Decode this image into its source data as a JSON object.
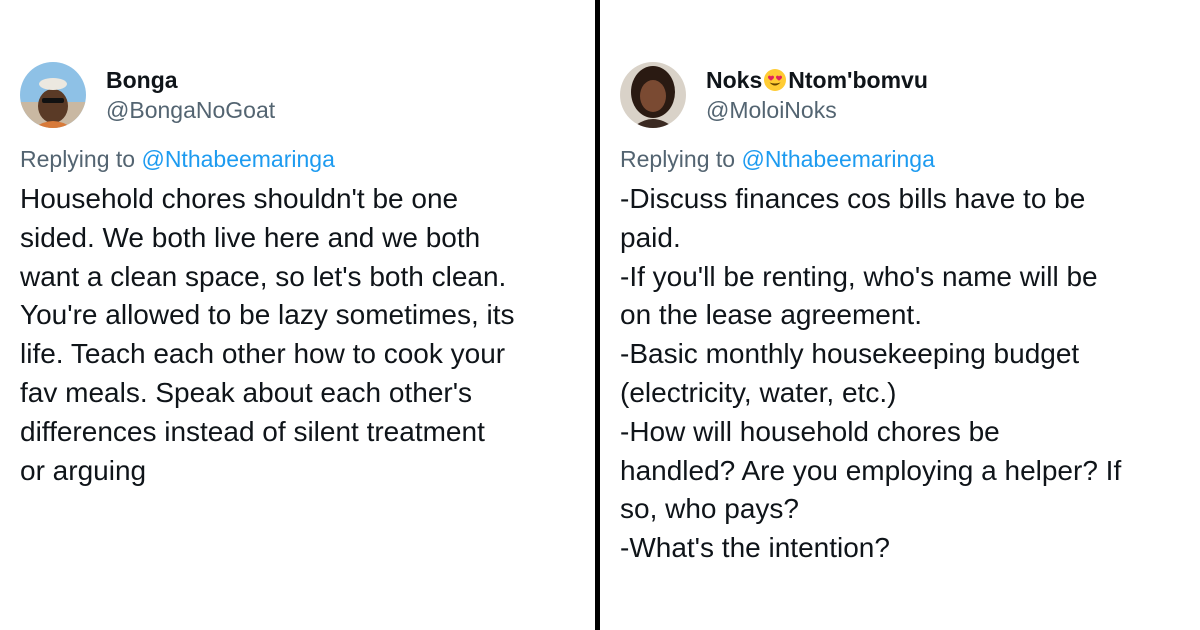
{
  "tweets": [
    {
      "display_name": "Bonga",
      "handle": "@BongaNoGoat",
      "reply_prefix": "Replying to",
      "reply_to": "@Nthabeemaringa",
      "lines": [
        "Household chores shouldn't be one",
        "sided. We both live here and we both",
        "want a clean space, so let's both clean.",
        "You're allowed to be lazy sometimes, its",
        "life. Teach each other how to cook your",
        "fav meals. Speak about each other's",
        "differences instead of silent treatment",
        "or arguing"
      ]
    },
    {
      "display_name_part1": "Noks",
      "display_name_emoji": "heart-eyes-emoji-icon",
      "display_name_part2": "Ntom'bomvu",
      "handle": "@MoloiNoks",
      "reply_prefix": "Replying to",
      "reply_to": "@Nthabeemaringa",
      "lines": [
        "-Discuss finances cos bills have to be",
        "paid.",
        "-If you'll be renting, who's name will be",
        "on the lease agreement.",
        "-Basic monthly housekeeping budget",
        "(electricity, water, etc.)",
        "-How will household chores be",
        "handled? Are you employing a helper? If",
        "so, who pays?",
        "-What's the intention?"
      ]
    }
  ],
  "colors": {
    "text": "#0f1419",
    "secondary": "#536471",
    "mention": "#1d9bf0",
    "divider": "#000000",
    "background": "#ffffff"
  }
}
